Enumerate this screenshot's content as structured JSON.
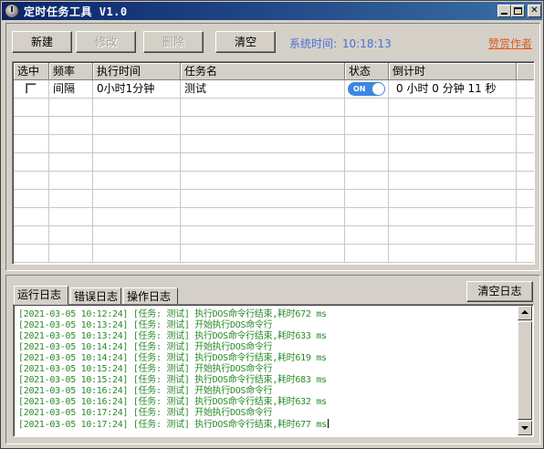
{
  "window": {
    "title": "定时任务工具 V1.0",
    "icon": "clock-app-icon"
  },
  "toolbar": {
    "new_label": "新建",
    "edit_label": "修改",
    "delete_label": "删除",
    "clear_label": "清空",
    "system_time_label": "系统时间:",
    "system_time_value": "10:18:13",
    "donate_label": "赞赏作者"
  },
  "grid": {
    "columns": [
      "选中",
      "频率",
      "执行时间",
      "任务名",
      "状态",
      "倒计时"
    ],
    "rows": [
      {
        "selected": false,
        "frequency": "间隔",
        "exec_time": "0小时1分钟",
        "task_name": "测试",
        "status_on": true,
        "status_text": "ON",
        "countdown": "0 小时  0 分钟 11 秒"
      }
    ]
  },
  "log": {
    "tabs": [
      "运行日志",
      "错误日志",
      "操作日志"
    ],
    "active_tab": "运行日志",
    "clear_label": "清空日志",
    "lines": [
      "[2021-03-05 10:12:24] [任务: 测试] 执行DOS命令行结束,耗时672 ms",
      "[2021-03-05 10:13:24] [任务: 测试] 开始执行DOS命令行",
      "[2021-03-05 10:13:24] [任务: 测试] 执行DOS命令行结束,耗时633 ms",
      "[2021-03-05 10:14:24] [任务: 测试] 开始执行DOS命令行",
      "[2021-03-05 10:14:24] [任务: 测试] 执行DOS命令行结束,耗时619 ms",
      "[2021-03-05 10:15:24] [任务: 测试] 开始执行DOS命令行",
      "[2021-03-05 10:15:24] [任务: 测试] 执行DOS命令行结束,耗时683 ms",
      "[2021-03-05 10:16:24] [任务: 测试] 开始执行DOS命令行",
      "[2021-03-05 10:16:24] [任务: 测试] 执行DOS命令行结束,耗时632 ms",
      "[2021-03-05 10:17:24] [任务: 测试] 开始执行DOS命令行",
      "[2021-03-05 10:17:24] [任务: 测试] 执行DOS命令行结束,耗时677 ms"
    ],
    "text_color": "#2a8a2a"
  },
  "colors": {
    "title_bar": "#0a246a",
    "system_time": "#4a6fd8",
    "donate_link": "#e05a1a",
    "toggle_on": "#3d87e0"
  }
}
